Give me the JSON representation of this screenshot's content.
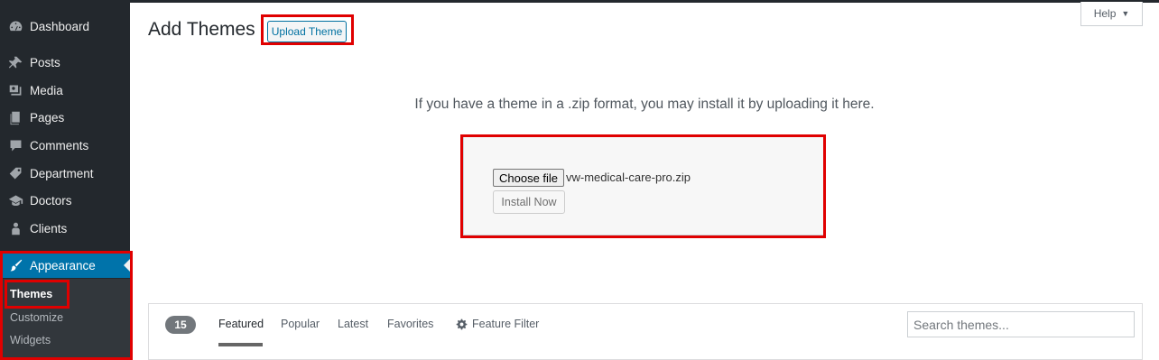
{
  "sidebar": {
    "items": [
      {
        "label": "Dashboard",
        "icon": "dashboard-icon"
      },
      {
        "label": "Posts",
        "icon": "pin-icon"
      },
      {
        "label": "Media",
        "icon": "media-icon"
      },
      {
        "label": "Pages",
        "icon": "pages-icon"
      },
      {
        "label": "Comments",
        "icon": "comment-icon"
      },
      {
        "label": "Department",
        "icon": "tag-icon"
      },
      {
        "label": "Doctors",
        "icon": "graduation-cap-icon"
      },
      {
        "label": "Clients",
        "icon": "person-icon"
      },
      {
        "label": "Appearance",
        "icon": "paintbrush-icon",
        "active": true
      }
    ],
    "submenu": [
      {
        "label": "Themes",
        "current": true
      },
      {
        "label": "Customize"
      },
      {
        "label": "Widgets"
      }
    ]
  },
  "header": {
    "title": "Add Themes",
    "upload_button": "Upload Theme",
    "help_button": "Help",
    "help_caret": "▼"
  },
  "upload": {
    "description": "If you have a theme in a .zip format, you may install it by uploading it here.",
    "choose_file_label": "Choose file",
    "file_name": "vw-medical-care-pro.zip",
    "install_button": "Install Now"
  },
  "filter_bar": {
    "count": "15",
    "tabs": [
      "Featured",
      "Popular",
      "Latest",
      "Favorites"
    ],
    "current_tab": "Featured",
    "feature_filter": "Feature Filter",
    "search_placeholder": "Search themes..."
  },
  "colors": {
    "sidebar_bg": "#23282d",
    "submenu_bg": "#32373c",
    "active_blue": "#0073aa",
    "highlight_red": "#e00000"
  }
}
